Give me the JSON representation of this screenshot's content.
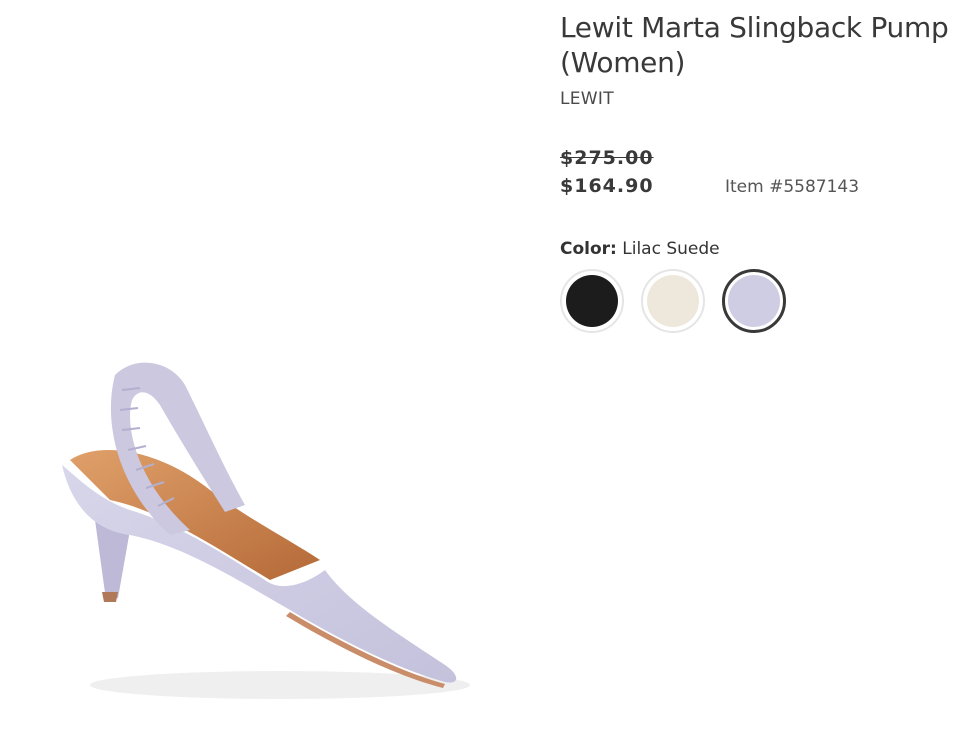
{
  "product": {
    "title_line1": "Lewit Marta Slingback Pump",
    "title_line2": "(Women)",
    "brand": "LEWIT",
    "price_original": "$275.00",
    "price_sale": "$164.90",
    "item_number": "Item #5587143",
    "image_icon": "slingback-pump-image"
  },
  "color": {
    "label": "Color:",
    "selected": "Lilac Suede",
    "swatches": [
      {
        "color": "#1c1c1c",
        "selected": false
      },
      {
        "color": "#eee8dc",
        "selected": false
      },
      {
        "color": "#cfcde3",
        "selected": true
      }
    ]
  }
}
